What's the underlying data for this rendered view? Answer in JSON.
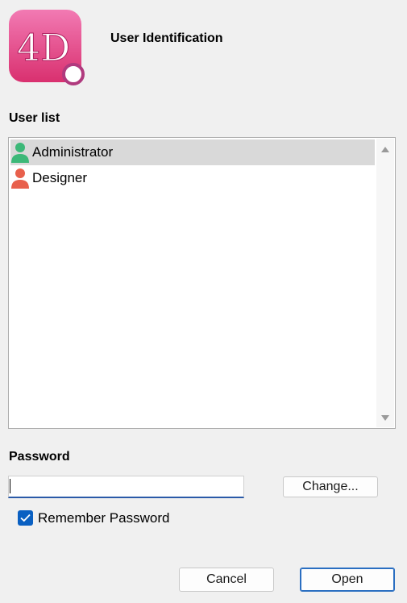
{
  "header": {
    "logo_text": "4D",
    "title": "User Identification"
  },
  "user_list": {
    "label": "User list",
    "items": [
      {
        "name": "Administrator",
        "selected": true,
        "icon": "user-icon",
        "icon_color": "#3cb878"
      },
      {
        "name": "Designer",
        "selected": false,
        "icon": "user-icon",
        "icon_color": "#e8604c"
      }
    ]
  },
  "password": {
    "label": "Password",
    "value": "",
    "change_label": "Change..."
  },
  "remember": {
    "label": "Remember Password",
    "checked": true
  },
  "footer": {
    "cancel_label": "Cancel",
    "open_label": "Open"
  },
  "colors": {
    "accent": "#0a60c2",
    "logo_pink": "#e8458f"
  }
}
